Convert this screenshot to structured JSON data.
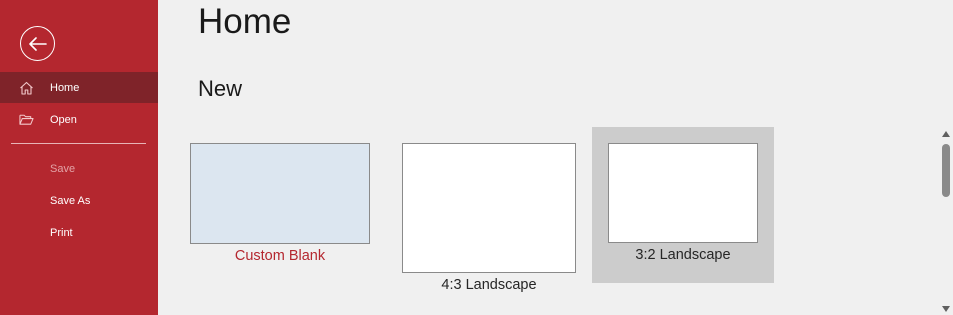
{
  "sidebar": {
    "items": [
      {
        "label": "Home",
        "icon": "home-icon",
        "selected": true
      },
      {
        "label": "Open",
        "icon": "folder-open-icon"
      }
    ],
    "file_items": [
      {
        "label": "Save",
        "disabled": true
      },
      {
        "label": "Save As"
      },
      {
        "label": "Print"
      }
    ]
  },
  "main": {
    "title": "Home",
    "section": "New",
    "templates": [
      {
        "label": "Custom Blank",
        "label_color": "#b4272f",
        "thumb_fill": "#dce6f0"
      },
      {
        "label": "4:3 Landscape",
        "thumb_fill": "#ffffff"
      },
      {
        "label": "3:2 Landscape",
        "thumb_fill": "#ffffff",
        "selected": true
      }
    ]
  },
  "colors": {
    "accent": "#b4272f",
    "sidebar_selected": "#7f2329",
    "background": "#f0f0f0",
    "tile_selected_bg": "#cccccc"
  }
}
